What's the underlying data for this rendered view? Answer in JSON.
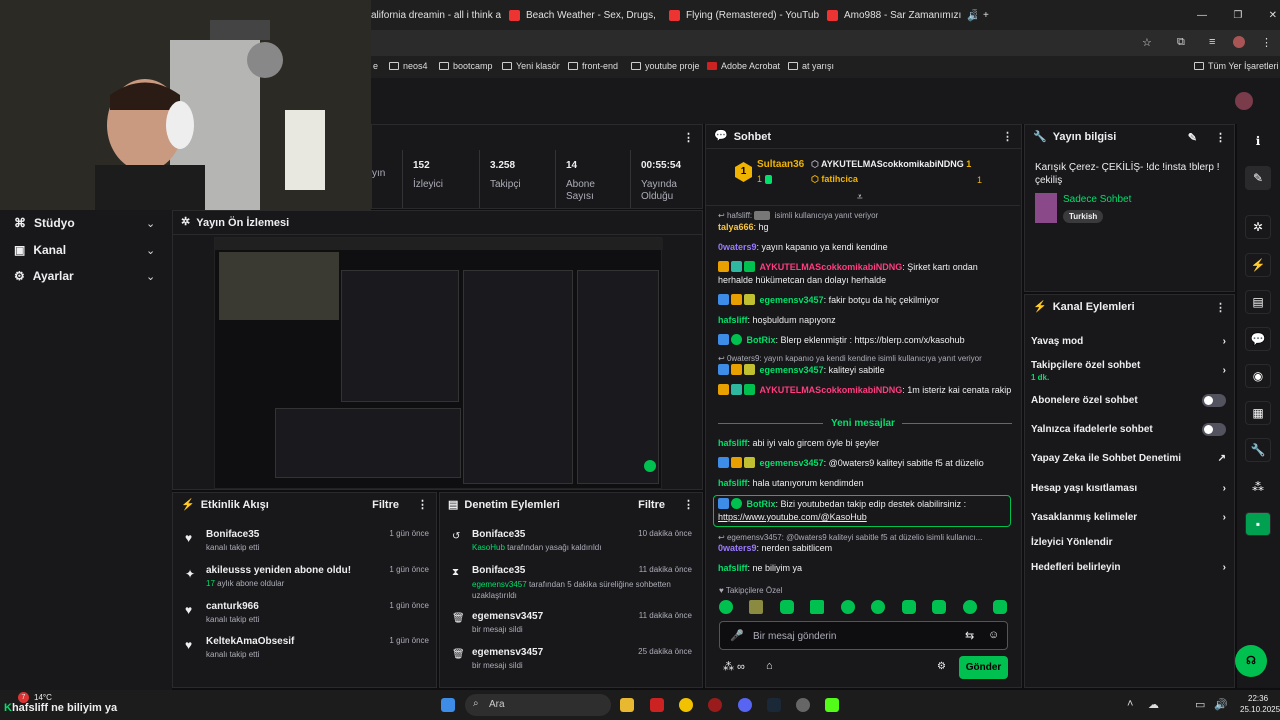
{
  "browser": {
    "tabs": [
      {
        "label": "alifornia dreamin - all i think a"
      },
      {
        "label": "Beach Weather - Sex, Drugs, Et"
      },
      {
        "label": "Flying (Remastered) - YouTube"
      },
      {
        "label": "Amo988 - Sar Zamanımızı"
      }
    ],
    "bookmarks": [
      "e",
      "neos4",
      "bootcamp",
      "Yeni klasör",
      "front-end",
      "youtube proje",
      "Adobe Acrobat",
      "at yarışı"
    ],
    "all_bookmarks": "Tüm Yer İşaretleri"
  },
  "stats": [
    {
      "value": "",
      "label": "yın"
    },
    {
      "value": "152",
      "label": "İzleyici"
    },
    {
      "value": "3.258",
      "label": "Takipçi"
    },
    {
      "value": "14",
      "label": "Abone Sayısı"
    },
    {
      "value": "00:55:54",
      "label": "Yayında Olduğu"
    }
  ],
  "left_nav": [
    {
      "label": "Stüdyo",
      "icon": "studio-icon"
    },
    {
      "label": "Kanal",
      "icon": "channel-icon"
    },
    {
      "label": "Ayarlar",
      "icon": "gear-icon"
    }
  ],
  "preview": {
    "title": "Yayın Ön İzlemesi"
  },
  "activity": {
    "title": "Etkinlik Akışı",
    "filter": "Filtre",
    "items": [
      {
        "title": "Boniface35",
        "sub": "kanalı takip etti",
        "time": "1 gün önce",
        "highlight": ""
      },
      {
        "title": "akileusss yeniden abone oldu!",
        "sub": "aylık abone oldular",
        "time": "1 gün önce",
        "highlight": "17"
      },
      {
        "title": "canturk966",
        "sub": "kanalı takip etti",
        "time": "1 gün önce",
        "highlight": ""
      },
      {
        "title": "KeltekAmaObsesif",
        "sub": "kanalı takip etti",
        "time": "1 gün önce",
        "highlight": ""
      }
    ]
  },
  "moderation": {
    "title": "Denetim Eylemleri",
    "filter": "Filtre",
    "items": [
      {
        "title": "Boniface35",
        "who": "KasoHub",
        "sub": " tarafından yasağı kaldırıldı",
        "time": "10 dakika önce"
      },
      {
        "title": "Boniface35",
        "who": "egemensv3457",
        "sub": " tarafından 5 dakika süreliğine sohbetten uzaklaştırıldı",
        "time": "11 dakika önce"
      },
      {
        "title": "egemensv3457",
        "who": "",
        "sub": "bir mesajı sildi",
        "time": "11 dakika önce"
      },
      {
        "title": "egemensv3457",
        "who": "",
        "sub": "bir mesajı sildi",
        "time": "25 dakika önce"
      }
    ]
  },
  "chat": {
    "title": "Sohbet",
    "top_gifter": {
      "rank": "1",
      "name": "Sultaan36",
      "count": "1"
    },
    "gifters": [
      {
        "name": "AYKUTELMAScokkomikabiNDNG",
        "count": "1"
      },
      {
        "name": "fatihcica",
        "count": "1"
      }
    ],
    "messages": [
      {
        "reply": "hafsliff:",
        "reply_tail": "isimli kullanıcıya yanıt veriyor",
        "name": "talya666",
        "text": "hg",
        "color": "#f5c542"
      },
      {
        "name": "0waters9",
        "text": "yayın kapanıo ya kendi kendine",
        "color": "#9b7bff"
      },
      {
        "name": "AYKUTELMAScokkomikabiNDNG",
        "text": "Şirket kartı ondan herhalde hükümetcan dan dolayı herhalde",
        "color": "#ff3d7f"
      },
      {
        "name": "egemensv3457",
        "text": "fakir botçu da hiç çekilmiyor",
        "color": "#00e06a"
      },
      {
        "name": "hafsliff",
        "text": "hoşbuldum napıyonz",
        "color": "#00e06a"
      },
      {
        "name": "BotRix",
        "text": "Blerp eklenmiştir : https://blerp.com/x/kasohub",
        "color": "#00e06a"
      },
      {
        "reply": "0waters9: yayın kapanıo ya kendi kendine",
        "reply_tail": "isimli kullanıcıya yanıt veriyor",
        "name": "egemensv3457",
        "text": "kaliteyi sabitle",
        "color": "#00e06a"
      },
      {
        "name": "AYKUTELMAScokkomikabiNDNG",
        "text": "1m isteriz kai cenata rakip",
        "color": "#ff3d7f"
      }
    ],
    "new_divider": "Yeni mesajlar",
    "new_messages": [
      {
        "name": "hafsliff",
        "text": "abi iyi valo gircem öyle bi şeyler",
        "color": "#00e06a"
      },
      {
        "name": "egemensv3457",
        "text": "@0waters9 kaliteyi sabitle f5 at düzelio",
        "color": "#00e06a"
      },
      {
        "name": "hafsliff",
        "text": "hala utanıyorum kendimden",
        "color": "#00e06a"
      },
      {
        "name": "BotRix",
        "text": "Bizi youtubedan takip edip destek olabilirsiniz :",
        "link": "https://www.youtube.com/@KasoHub",
        "color": "#00e06a"
      },
      {
        "reply": "egemensv3457: @0waters9 kaliteyi sabitle f5 at düzelio isimli kullanıcı...",
        "name": "0waters9",
        "text": "nerden sabitlicem",
        "color": "#9b7bff"
      },
      {
        "name": "hafsliff",
        "text": "ne biliyim ya",
        "color": "#00e06a"
      }
    ],
    "emote_label": "Takipçilere Özel",
    "input_placeholder": "Bir mesaj gönderin",
    "send": "Gönder"
  },
  "stream_info": {
    "title": "Yayın bilgisi",
    "stream_title": "Karışık Çerez- ÇEKİLİŞ- !dc !insta !blerp ! çekiliş",
    "category": "Sadece Sohbet",
    "tag": "Turkish"
  },
  "channel_actions": {
    "title": "Kanal Eylemleri",
    "items": [
      {
        "label": "Yavaş mod",
        "sub": "",
        "control": "arrow"
      },
      {
        "label": "Takipçilere özel sohbet",
        "sub": "1 dk.",
        "control": "arrow"
      },
      {
        "label": "Abonelere özel sohbet",
        "sub": "",
        "control": "toggle"
      },
      {
        "label": "Yalnızca ifadelerle sohbet",
        "sub": "",
        "control": "toggle"
      },
      {
        "label": "Yapay Zeka ile Sohbet Denetimi",
        "sub": "",
        "control": "external"
      },
      {
        "label": "Hesap yaşı kısıtlaması",
        "sub": "",
        "control": "arrow"
      },
      {
        "label": "Yasaklanmış kelimeler",
        "sub": "",
        "control": "arrow"
      },
      {
        "label": "İzleyici Yönlendir",
        "sub": "",
        "control": "none"
      },
      {
        "label": "Hedefleri belirleyin",
        "sub": "",
        "control": "arrow"
      }
    ]
  },
  "taskbar": {
    "weather": "14°C",
    "badge": "7",
    "ticker_name": "hafsliff",
    "ticker_text": "ne biliyim ya",
    "search": "Ara",
    "time": "22:36",
    "date": "25.10.2025"
  }
}
